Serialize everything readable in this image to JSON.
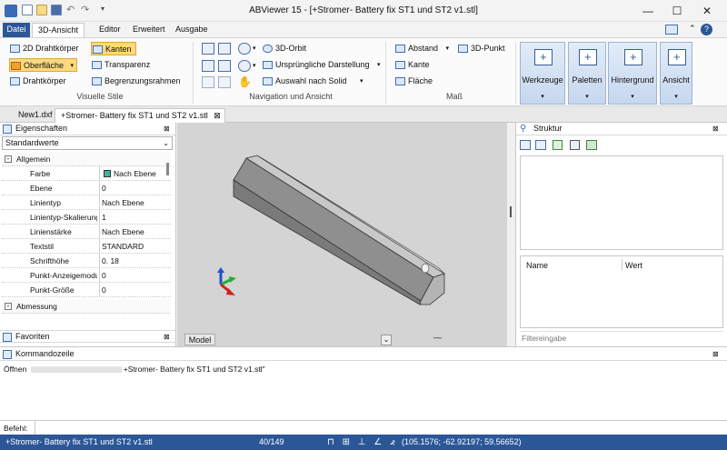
{
  "window": {
    "title": "ABViewer 15 - [+Stromer- Battery fix ST1 und ST2 v1.stl]",
    "min_glyph": "—",
    "max_glyph": "☐",
    "close_glyph": "✕"
  },
  "ribbon_tabs": [
    "Datei",
    "3D-Ansicht",
    "Editor",
    "Erweitert",
    "Ausgabe"
  ],
  "ribbon": {
    "visual_styles": {
      "items": [
        "2D Drahtkörper",
        "Kanten",
        "Oberfläche",
        "Transparenz",
        "Drahtkörper",
        "Begrenzungsrahmen"
      ],
      "group_label": "Visuelle Stile"
    },
    "navigation": {
      "items": [
        "3D-Orbit",
        "Ursprüngliche Darstellung",
        "Auswahl nach Solid"
      ],
      "group_label": "Navigation und Ansicht"
    },
    "measure": {
      "items": [
        "Abstand",
        "3D-Punkt",
        "Kante",
        "Fläche"
      ],
      "group_label": "Maß"
    },
    "big_buttons": [
      "Werkzeuge",
      "Paletten",
      "Hintergrund",
      "Ansicht"
    ]
  },
  "doc_tabs": [
    "New1.dxf",
    "+Stromer- Battery fix ST1 und ST2 v1.stl"
  ],
  "properties": {
    "title": "Eigenschaften",
    "selector": "Standardwerte",
    "section_general": "Allgemein",
    "rows": [
      {
        "name": "Farbe",
        "value": "Nach Ebene"
      },
      {
        "name": "Ebene",
        "value": "0"
      },
      {
        "name": "Linientyp",
        "value": "Nach Ebene"
      },
      {
        "name": "Linientyp-Skalierung",
        "value": "1"
      },
      {
        "name": "Linienstärke",
        "value": "Nach Ebene"
      },
      {
        "name": "Textstil",
        "value": "STANDARD"
      },
      {
        "name": "Schrifthöhe",
        "value": "0. 18"
      },
      {
        "name": "Punkt-Anzeigemodus",
        "value": "0"
      },
      {
        "name": "Punkt-Größe",
        "value": "0"
      }
    ],
    "section_dimension": "Abmessung",
    "favorites": "Favoriten"
  },
  "viewport": {
    "model_tab": "Model",
    "layout_tab": "—"
  },
  "structure": {
    "title": "Struktur",
    "col_name": "Name",
    "col_value": "Wert",
    "filter_placeholder": "Filtereingabe"
  },
  "command": {
    "title": "Kommandozeile",
    "output_prefix": "Öffnen",
    "output_file": "+Stromer- Battery fix ST1 und ST2 v1.stl\"",
    "input_label": "Befehl:"
  },
  "status": {
    "file": "+Stromer- Battery fix ST1 und ST2 v1.stl",
    "page": "40/149",
    "coords": "(105.1576; -62.92197; 59.56652)"
  },
  "colors": {
    "accent": "#2b5797",
    "selected": "#fcd97a",
    "viewport_bg": "#d4d4d4",
    "color_swatch": "#3cb4a0"
  }
}
